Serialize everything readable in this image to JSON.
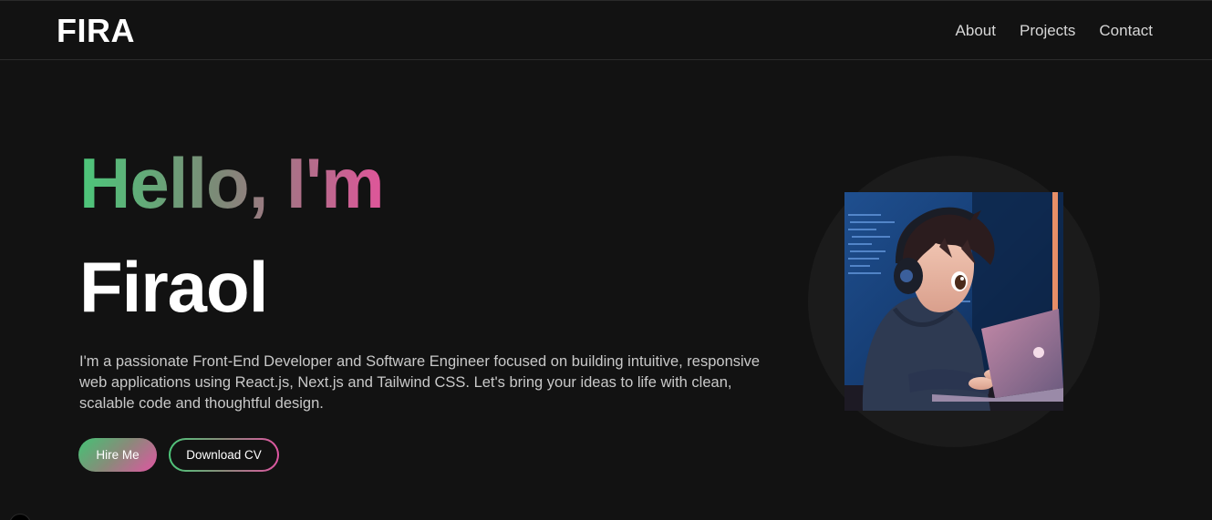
{
  "brand": {
    "logo": "FIRA"
  },
  "nav": {
    "items": [
      {
        "label": "About"
      },
      {
        "label": "Projects"
      },
      {
        "label": "Contact"
      }
    ]
  },
  "hero": {
    "greeting": "Hello, I'm",
    "name": "Firaol",
    "bio": "I'm a passionate Front-End Developer and Software Engineer focused on building intuitive, responsive web applications using React.js, Next.js and Tailwind CSS. Let's bring your ideas to life with clean, scalable code and thoughtful design.",
    "hire_label": "Hire Me",
    "cv_label": "Download CV"
  },
  "avatar": {
    "icon": "avatar-illustration"
  },
  "colors": {
    "background": "#121212",
    "gradient_start": "#4cc77a",
    "gradient_end": "#e055a2",
    "text_primary": "#ffffff",
    "text_muted": "#c9c9c9"
  }
}
